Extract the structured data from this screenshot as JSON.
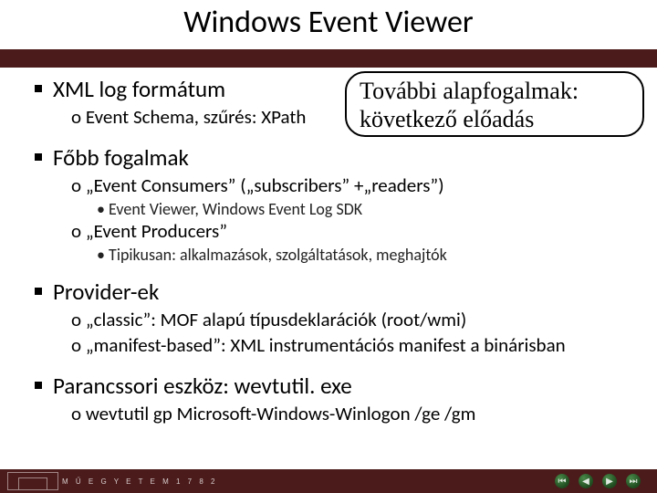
{
  "title": "Windows Event Viewer",
  "callout": {
    "line1": "További alapfogalmak:",
    "line2": "következő előadás"
  },
  "b1": {
    "text": "XML log formátum",
    "sub1": "Event Schema, szűrés: XPath"
  },
  "b2": {
    "text": "Főbb fogalmak",
    "sub1": "„Event Consumers” („subscribers” +„readers”)",
    "sub1a": "Event Viewer, Windows Event Log SDK",
    "sub2": "„Event Producers”",
    "sub2a": "Tipikusan: alkalmazások, szolgáltatások, meghajtók"
  },
  "b3": {
    "text": "Provider-ek",
    "sub1": "„classic”: MOF alapú típusdeklarációk (root/wmi)",
    "sub2": "„manifest-based”: XML instrumentációs manifest a binárisban"
  },
  "b4": {
    "text": "Parancssori eszköz: wevtutil. exe",
    "sub1": "wevtutil gp Microsoft-Windows-Winlogon /ge /gm"
  },
  "footer": {
    "letters": "M Ű E G Y E T E M  1 7 8 2",
    "nav": {
      "first": "⏮",
      "prev": "◀",
      "next": "▶",
      "last": "⏭"
    }
  }
}
